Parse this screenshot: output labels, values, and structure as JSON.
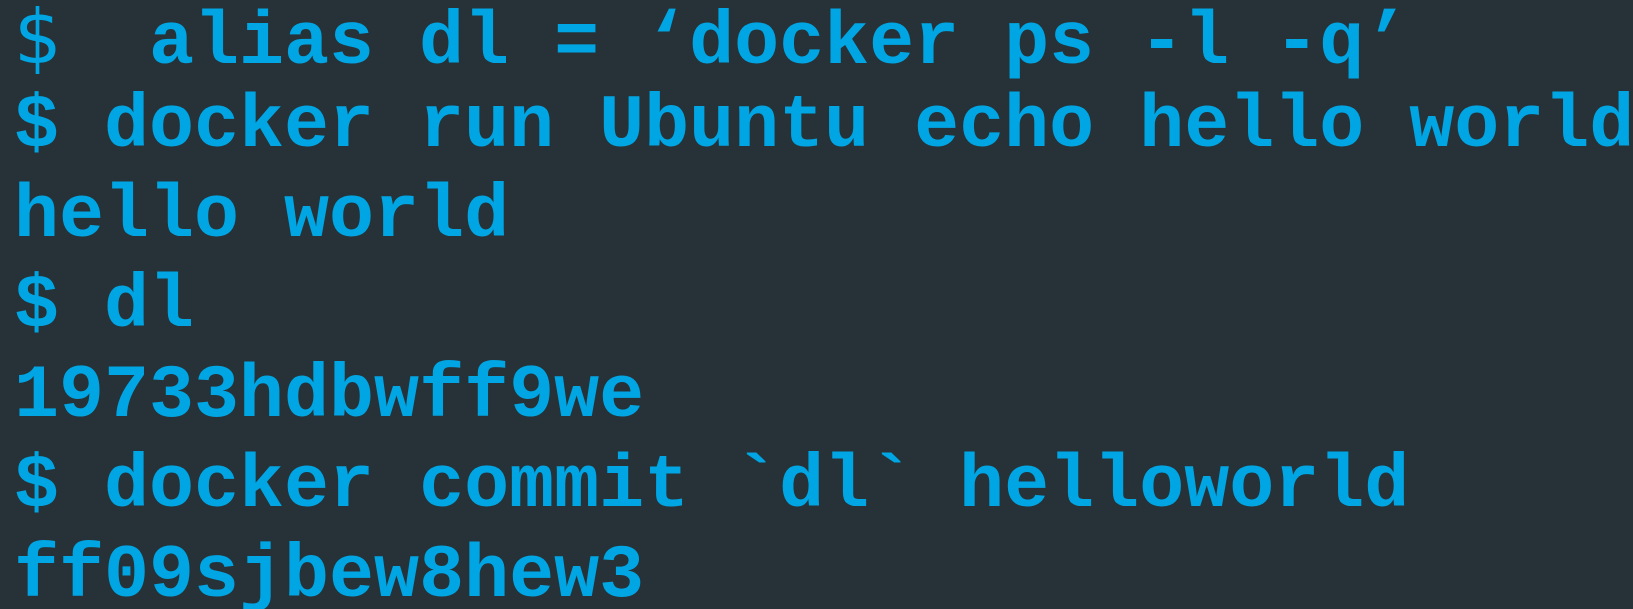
{
  "terminal": {
    "lines": [
      {
        "prompt": "$",
        "text": " alias dl = ‘docker ps -l -q’"
      },
      {
        "prompt": "$",
        "text": " docker run Ubuntu echo hello world"
      },
      {
        "prompt": "",
        "text": "hello world"
      },
      {
        "prompt": "$",
        "text": " dl"
      },
      {
        "prompt": "",
        "text": "19733hdbwff9we"
      },
      {
        "prompt": "$",
        "text": " docker commit `dl` helloworld"
      },
      {
        "prompt": "",
        "text": "ff09sjbew8hew3"
      }
    ]
  },
  "colors": {
    "background": "#263238",
    "text": "#00A5E3"
  }
}
